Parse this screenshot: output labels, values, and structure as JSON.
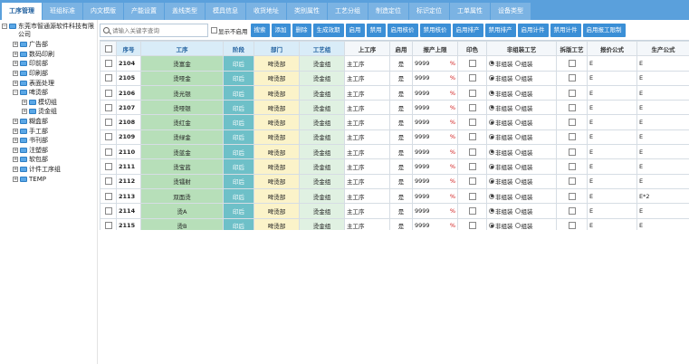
{
  "tabs": [
    "工序管理",
    "班组标准",
    "内文模版",
    "产能设置",
    "盖线类型",
    "模具信息",
    "收货地址",
    "类别属性",
    "工艺分组",
    "制造定位",
    "标识定位",
    "工单属性",
    "设备类型"
  ],
  "tree": {
    "root": "东莞市智通源软件科技有限公司",
    "nodes": [
      {
        "label": "广告部",
        "level": 1,
        "exp": "+"
      },
      {
        "label": "数码印刷",
        "level": 1,
        "exp": "+"
      },
      {
        "label": "印前部",
        "level": 1,
        "exp": "+"
      },
      {
        "label": "印刷部",
        "level": 1,
        "exp": "+"
      },
      {
        "label": "表面处理",
        "level": 1,
        "exp": "+"
      },
      {
        "label": "啤烫部",
        "level": 1,
        "exp": "-"
      },
      {
        "label": "模切组",
        "level": 2,
        "exp": "+"
      },
      {
        "label": "烫金组",
        "level": 2,
        "exp": "+"
      },
      {
        "label": "糊盒部",
        "level": 1,
        "exp": "+"
      },
      {
        "label": "手工部",
        "level": 1,
        "exp": "+"
      },
      {
        "label": "书刊部",
        "level": 1,
        "exp": "+"
      },
      {
        "label": "注塑部",
        "level": 1,
        "exp": "+"
      },
      {
        "label": "软包部",
        "level": 1,
        "exp": "+"
      },
      {
        "label": "计件工序组",
        "level": 1,
        "exp": "+"
      },
      {
        "label": "TEMP",
        "level": 1,
        "exp": "+"
      }
    ]
  },
  "toolbar": {
    "search_placeholder": "请输入关键字查询",
    "show_disabled_label": "显示不启用",
    "buttons": [
      "搜索",
      "添加",
      "删除",
      "生成效期",
      "启用",
      "禁用",
      "启用核价",
      "禁用核价",
      "启用排产",
      "禁用排产",
      "启用计件",
      "禁用计件",
      "启用报工限制"
    ]
  },
  "table": {
    "headers": [
      "序号",
      "工序",
      "阶段",
      "部门",
      "工艺组",
      "上工序",
      "启用",
      "报产上限",
      "印色",
      "非组装工艺",
      "拆版工艺",
      "报价公式",
      "生产公式"
    ],
    "pct": "%",
    "radio_a": "非组装",
    "radio_b": "组装",
    "rows": [
      {
        "seq": "2104",
        "proc": "烫富金",
        "stage": "印后",
        "dept": "啤烫部",
        "grp": "烫金组",
        "prev": "主工序",
        "on": "是",
        "cap": "9999",
        "qf": "E",
        "pf": "E"
      },
      {
        "seq": "2105",
        "proc": "烫哑金",
        "stage": "印后",
        "dept": "啤烫部",
        "grp": "烫金组",
        "prev": "主工序",
        "on": "是",
        "cap": "9999",
        "qf": "E",
        "pf": "E"
      },
      {
        "seq": "2106",
        "proc": "烫光银",
        "stage": "印后",
        "dept": "啤烫部",
        "grp": "烫金组",
        "prev": "主工序",
        "on": "是",
        "cap": "9999",
        "qf": "E",
        "pf": "E"
      },
      {
        "seq": "2107",
        "proc": "烫哑银",
        "stage": "印后",
        "dept": "啤烫部",
        "grp": "烫金组",
        "prev": "主工序",
        "on": "是",
        "cap": "9999",
        "qf": "E",
        "pf": "E"
      },
      {
        "seq": "2108",
        "proc": "烫红金",
        "stage": "印后",
        "dept": "啤烫部",
        "grp": "烫金组",
        "prev": "主工序",
        "on": "是",
        "cap": "9999",
        "qf": "E",
        "pf": "E"
      },
      {
        "seq": "2109",
        "proc": "烫绿金",
        "stage": "印后",
        "dept": "啤烫部",
        "grp": "烫金组",
        "prev": "主工序",
        "on": "是",
        "cap": "9999",
        "qf": "E",
        "pf": "E"
      },
      {
        "seq": "2110",
        "proc": "烫蓝金",
        "stage": "印后",
        "dept": "啤烫部",
        "grp": "烫金组",
        "prev": "主工序",
        "on": "是",
        "cap": "9999",
        "qf": "E",
        "pf": "E"
      },
      {
        "seq": "2111",
        "proc": "烫宝蓝",
        "stage": "印后",
        "dept": "啤烫部",
        "grp": "烫金组",
        "prev": "主工序",
        "on": "是",
        "cap": "9999",
        "qf": "E",
        "pf": "E"
      },
      {
        "seq": "2112",
        "proc": "烫镭射",
        "stage": "印后",
        "dept": "啤烫部",
        "grp": "烫金组",
        "prev": "主工序",
        "on": "是",
        "cap": "9999",
        "qf": "E",
        "pf": "E"
      },
      {
        "seq": "2113",
        "proc": "双面烫",
        "stage": "印后",
        "dept": "啤烫部",
        "grp": "烫金组",
        "prev": "主工序",
        "on": "是",
        "cap": "9999",
        "qf": "E",
        "pf": "E*2"
      },
      {
        "seq": "2114",
        "proc": "烫A",
        "stage": "印后",
        "dept": "啤烫部",
        "grp": "烫金组",
        "prev": "主工序",
        "on": "是",
        "cap": "9999",
        "qf": "E",
        "pf": "E"
      },
      {
        "seq": "2115",
        "proc": "烫B",
        "stage": "印后",
        "dept": "啤烫部",
        "grp": "烫金组",
        "prev": "主工序",
        "on": "是",
        "cap": "9999",
        "qf": "E",
        "pf": "E"
      }
    ]
  }
}
